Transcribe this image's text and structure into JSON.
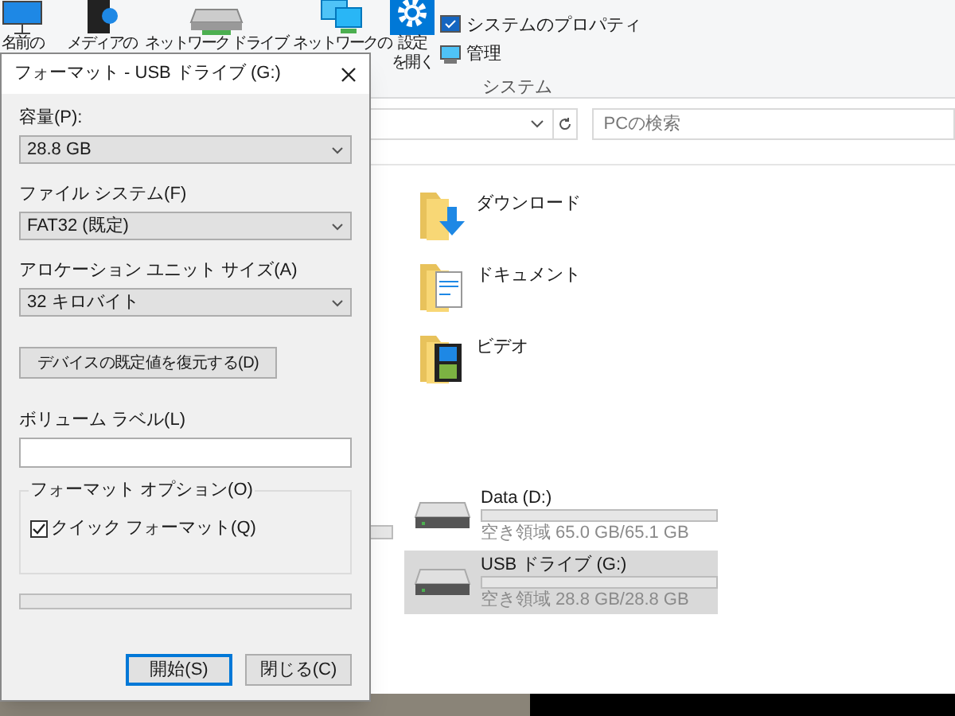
{
  "ribbon": {
    "items": [
      {
        "kind": "screen",
        "label": "名前の"
      },
      {
        "kind": "media",
        "label": "メディアの"
      },
      {
        "kind": "drive",
        "label": "ネットワーク ドライブ"
      },
      {
        "kind": "network",
        "label": "ネットワークの"
      },
      {
        "kind": "gear",
        "label": "設定",
        "label_2": "を開く"
      }
    ],
    "system_items": [
      {
        "kind": "properties",
        "label": "システムのプロパティ"
      },
      {
        "kind": "manage",
        "label": "管理"
      }
    ],
    "group_label": "システム"
  },
  "search": {
    "placeholder": "PCの検索"
  },
  "folders": [
    {
      "kind": "download",
      "label": "ダウンロード"
    },
    {
      "kind": "document",
      "label": "ドキュメント"
    },
    {
      "kind": "video",
      "label": "ビデオ"
    }
  ],
  "drives": [
    {
      "name": "Data (D:)",
      "free": "空き領域 65.0 GB/65.1 GB",
      "selected": false
    },
    {
      "name": "USB ドライブ (G:)",
      "free": "空き領域 28.8 GB/28.8 GB",
      "selected": true
    }
  ],
  "dialog": {
    "title": "フォーマット - USB ドライブ (G:)",
    "fields": [
      {
        "label": "容量(P):",
        "value": "28.8 GB"
      },
      {
        "label": "ファイル システム(F)",
        "value": "FAT32 (既定)"
      },
      {
        "label": "アロケーション ユニット サイズ(A)",
        "value": "32 キロバイト"
      }
    ],
    "restore_button": "デバイスの既定値を復元する(D)",
    "volume_label": {
      "label": "ボリューム ラベル(L)"
    },
    "options": {
      "legend": "フォーマット オプション(O)",
      "quick_format": {
        "label": "クイック フォーマット(Q)",
        "checked": true
      }
    },
    "progress": {
      "level": 0
    },
    "buttons": [
      {
        "label": "開始(S)",
        "default": true
      },
      {
        "label": "閉じる(C)",
        "default": false
      }
    ]
  }
}
